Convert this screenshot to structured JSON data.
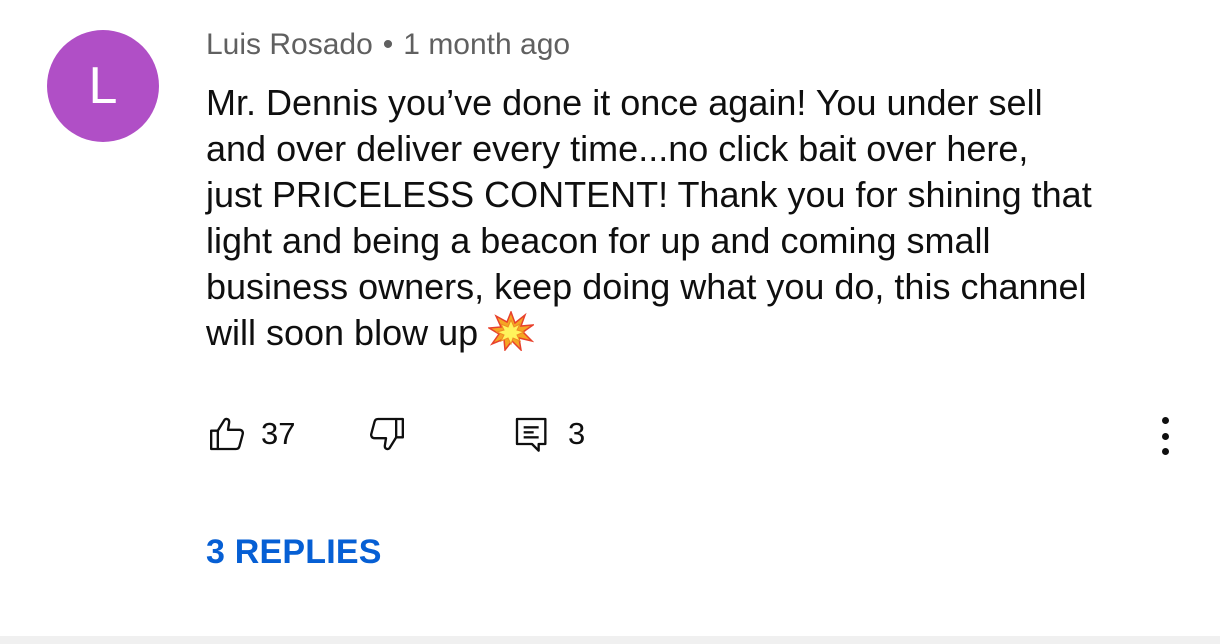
{
  "comment": {
    "avatar_letter": "L",
    "avatar_color": "#b04fc6",
    "author": "Luis Rosado",
    "separator": "•",
    "timestamp": "1 month ago",
    "lines": [
      "Mr. Dennis you’ve done it once again! You under sell",
      "and over deliver every time...no click bait over here,",
      "just PRICELESS CONTENT! Thank you for shining that",
      "light and being a beacon for up and coming small",
      "business owners, keep doing what you do, this channel",
      "will soon blow up"
    ],
    "emoji": "collision-emoji"
  },
  "actions": {
    "like_icon": "thumbs-up-icon",
    "like_count": "37",
    "dislike_icon": "thumbs-down-icon",
    "reply_icon": "comment-reply-icon",
    "reply_count": "3",
    "more_icon": "vertical-dots-icon"
  },
  "replies": {
    "label": "3 REPLIES",
    "color": "#065fd4"
  }
}
